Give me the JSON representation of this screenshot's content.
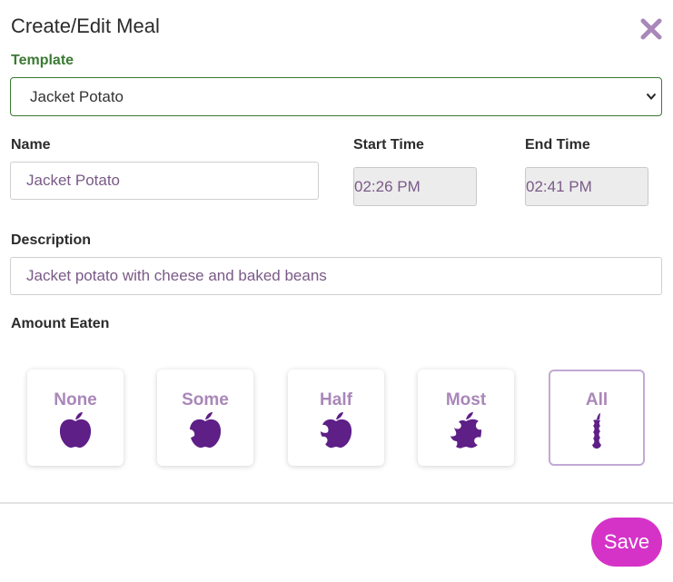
{
  "dialog": {
    "title": "Create/Edit Meal"
  },
  "template": {
    "label": "Template",
    "selected": "Jacket Potato"
  },
  "name": {
    "label": "Name",
    "value": "Jacket Potato"
  },
  "start_time": {
    "label": "Start Time",
    "value": "02:26 PM"
  },
  "end_time": {
    "label": "End Time",
    "value": "02:41 PM"
  },
  "description": {
    "label": "Description",
    "value": "Jacket potato with cheese and baked beans"
  },
  "amount_eaten": {
    "label": "Amount Eaten",
    "options": [
      {
        "label": "None",
        "icon": "apple-whole-icon"
      },
      {
        "label": "Some",
        "icon": "apple-bitten-icon"
      },
      {
        "label": "Half",
        "icon": "apple-half-icon"
      },
      {
        "label": "Most",
        "icon": "apple-most-icon"
      },
      {
        "label": "All",
        "icon": "apple-core-icon"
      }
    ],
    "selected": "All"
  },
  "actions": {
    "save_label": "Save"
  },
  "colors": {
    "accent_green": "#3a7a33",
    "apple_purple": "#5e1f87",
    "label_purple": "#a987b9",
    "save_pink": "#d533c8",
    "close_purple": "#a987b9"
  }
}
